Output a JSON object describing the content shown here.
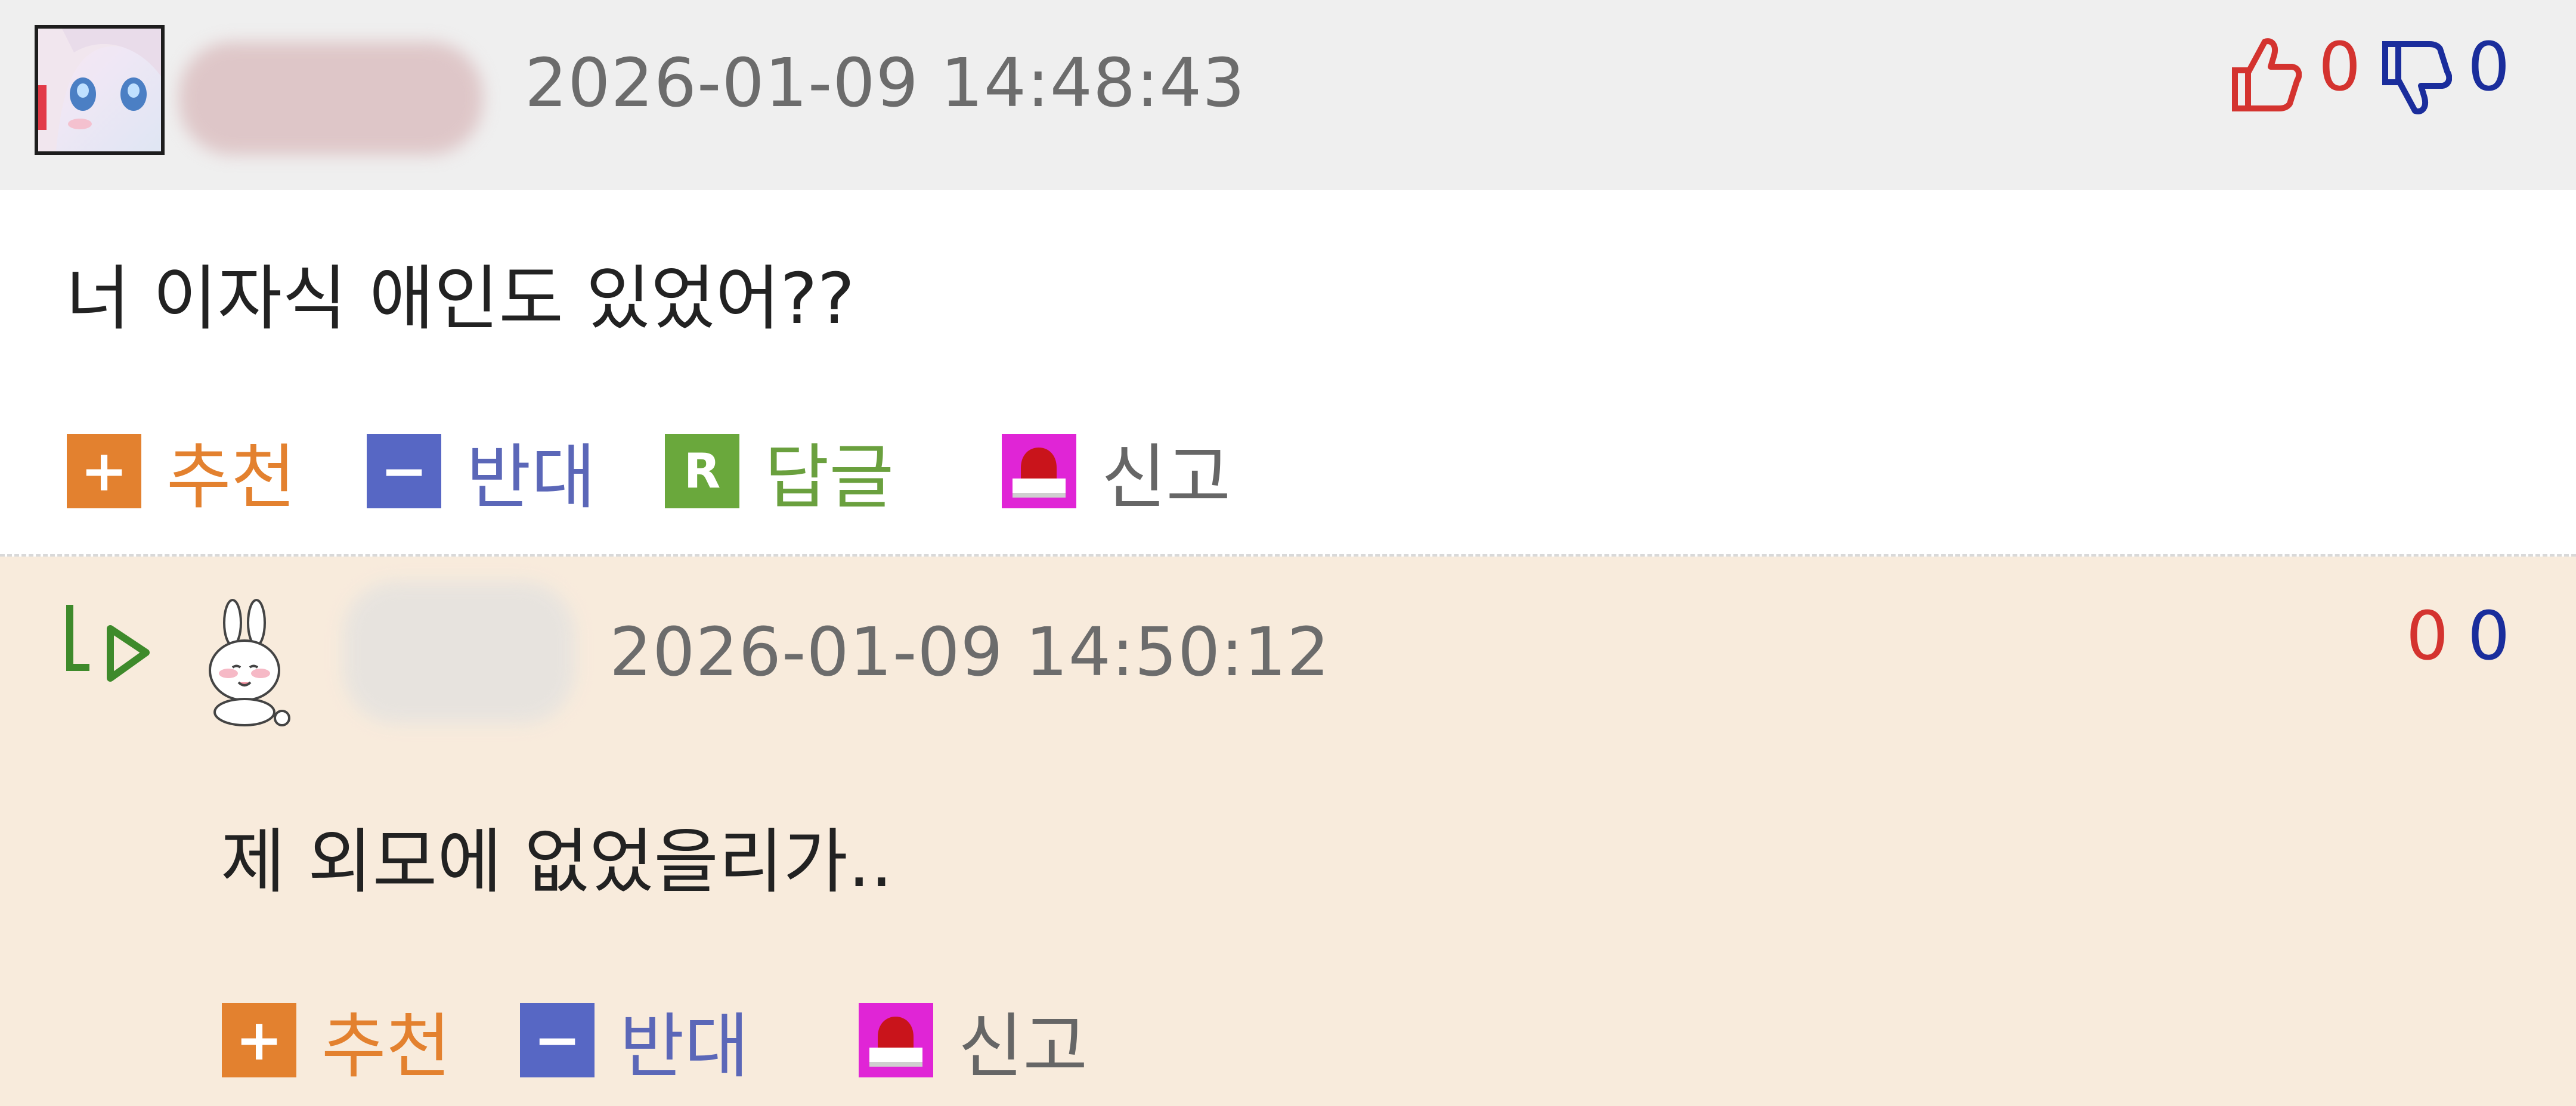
{
  "comment1": {
    "date": "2026-01-09 14:48:43",
    "likes": "0",
    "dislikes": "0",
    "text": "너 이자식 애인도 있었어??",
    "actions": {
      "recommend": "추천",
      "oppose": "반대",
      "reply": "답글",
      "reply_badge": "R",
      "report": "신고"
    }
  },
  "comment2": {
    "date": "2026-01-09 14:50:12",
    "likes": "0",
    "dislikes": "0",
    "text": "제 외모에 없었을리가..",
    "actions": {
      "recommend": "추천",
      "oppose": "반대",
      "report": "신고"
    }
  },
  "symbols": {
    "plus": "+",
    "minus": "−"
  },
  "colors": {
    "header_bg": "#efefef",
    "reply_bg": "#f8ebdc",
    "like_red": "#d4332f",
    "dislike_blue": "#1a2d9c",
    "recommend_orange": "#e3812f",
    "oppose_blue": "#5767c4",
    "reply_green": "#6aa83c",
    "report_magenta": "#e025d6"
  },
  "icons": [
    "thumbs-up-icon",
    "thumbs-down-icon",
    "reply-arrow-icon",
    "siren-icon",
    "anime-avatar",
    "bunny-avatar"
  ]
}
